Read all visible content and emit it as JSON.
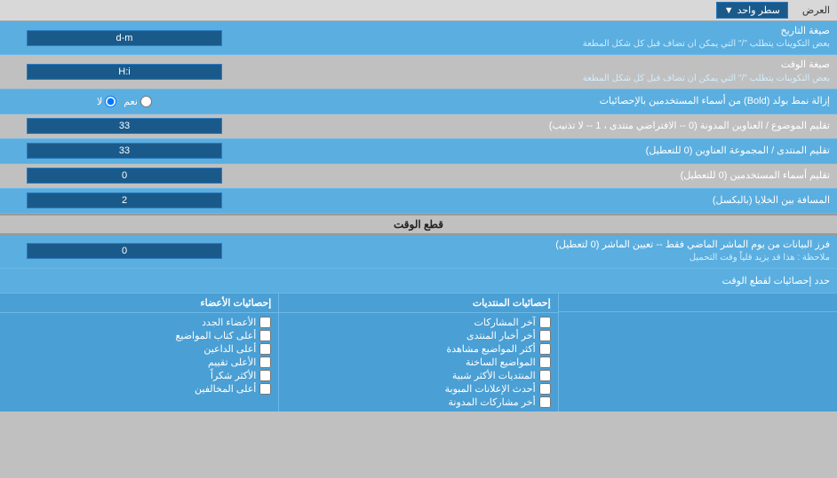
{
  "top_header": {
    "label_right": "العرض",
    "dropdown_label": "سطر واحد"
  },
  "rows": [
    {
      "id": "date_format",
      "label": "صيغة التاريخ",
      "sublabel": "بعض التكوينات يتطلب \"/\" التي يمكن ان تضاف قبل كل شكل المطعة",
      "input_value": "d-m",
      "type": "text"
    },
    {
      "id": "time_format",
      "label": "صيغة الوقت",
      "sublabel": "بعض التكوينات يتطلب \"/\" التي يمكن ان تضاف قبل كل شكل المطعة",
      "input_value": "H:i",
      "type": "text"
    },
    {
      "id": "bold_remove",
      "label": "إزالة نمط بولد (Bold) من أسماء المستخدمين بالإحصائيات",
      "radio_options": [
        {
          "value": "yes",
          "label": "نعم",
          "checked": false
        },
        {
          "value": "no",
          "label": "لا",
          "checked": true
        }
      ],
      "type": "radio"
    },
    {
      "id": "topics_forum",
      "label": "تقليم الموضوع / العناوين المدونة (0 -- الافتراضي منتدى ، 1 -- لا تذنيب)",
      "input_value": "33",
      "type": "text"
    },
    {
      "id": "titles_forum",
      "label": "تقليم المنتدى / المجموعة العناوين (0 للتعطيل)",
      "input_value": "33",
      "type": "text"
    },
    {
      "id": "usernames",
      "label": "تقليم أسماء المستخدمين (0 للتعطيل)",
      "input_value": "0",
      "type": "text"
    },
    {
      "id": "cell_spacing",
      "label": "المسافة بين الخلايا (بالبكسل)",
      "input_value": "2",
      "type": "text"
    }
  ],
  "section_cutoff": {
    "title": "قطع الوقت"
  },
  "cutoff_row": {
    "label_main": "فرز البيانات من يوم الماشر الماضي فقط -- تعيين الماشر (0 لتعطيل)",
    "label_note": "ملاحظة : هذا قد يزيد قلياً وقت التحميل",
    "input_value": "0"
  },
  "stats_section": {
    "limit_label": "حدد إحصائيات لقطع الوقت",
    "col1_header": "إحصائيات الأعضاء",
    "col2_header": "إحصائيات المنتديات",
    "col3_header": "",
    "col1_items": [
      {
        "label": "الأعضاء الجدد",
        "checked": false
      },
      {
        "label": "أعلى كتاب المواضيع",
        "checked": false
      },
      {
        "label": "أعلى الداعين",
        "checked": false
      },
      {
        "label": "الأعلى تقييم",
        "checked": false
      },
      {
        "label": "الأكثر شكراً",
        "checked": false
      },
      {
        "label": "أعلى المخالفين",
        "checked": false
      }
    ],
    "col2_items": [
      {
        "label": "آخر المشاركات",
        "checked": false
      },
      {
        "label": "أخر أخبار المنتدى",
        "checked": false
      },
      {
        "label": "أكثر المواضيع مشاهدة",
        "checked": false
      },
      {
        "label": "المواضيع الساخنة",
        "checked": false
      },
      {
        "label": "المنتديات الأكثر شبية",
        "checked": false
      },
      {
        "label": "أحدث الإعلانات المبوبة",
        "checked": false
      },
      {
        "label": "أخر مشاركات المدونة",
        "checked": false
      }
    ],
    "col3_items": []
  }
}
